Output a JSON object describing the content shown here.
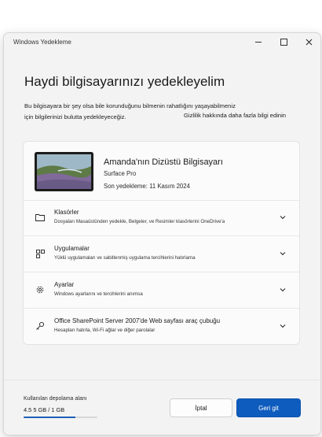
{
  "window": {
    "title": "Windows Yedekleme"
  },
  "heading": "Haydi bilgisayarınızı yedekleyelim",
  "description": {
    "line1": "Bu bilgisayara bir şey olsa bile korunduğunu bilmenin rahatlığını yaşayabilmeniz",
    "line2": "için bilgilerinizi bulutta yedekleyeceğiz.",
    "privacy_link": "Gizlilik hakkında daha fazla bilgi edinin"
  },
  "device": {
    "name": "Amanda'nın Dizüstü Bilgisayarı",
    "model": "Surface Pro",
    "last_backup": "Son yedekleme: 11 Kasım 2024"
  },
  "sections": [
    {
      "title": "Klasörler",
      "subtitle": "Dosyaları Masaüstünden yedekle, Belgeler, ve Resimler klasörlerini OneDrive'a",
      "icon": "folder-icon"
    },
    {
      "title": "Uygulamalar",
      "subtitle": "Yüklü uygulamaları ve sabitlenmiş uygulama tercihlerini hatırlama",
      "icon": "apps-icon"
    },
    {
      "title": "Ayarlar",
      "subtitle": "Windows ayarlarını ve tercihlerini anımsa",
      "icon": "gear-icon"
    },
    {
      "title": "Office SharePoint Server 2007'de Web sayfası araç çubuğu",
      "subtitle": "Hesapları hatırla, Wi-Fi ağlar ve diğer parolalar",
      "icon": "key-icon"
    }
  ],
  "footer": {
    "storage_label": "Kullanılan depolama alanı",
    "storage_value": "4.5 5 GB / 1 GB",
    "storage_fraction": 0.7,
    "cancel_label": "İptal",
    "back_label": "Geri git"
  },
  "colors": {
    "accent": "#0f5cbf",
    "background": "#f3f3f3",
    "card": "#fbfbfb"
  }
}
